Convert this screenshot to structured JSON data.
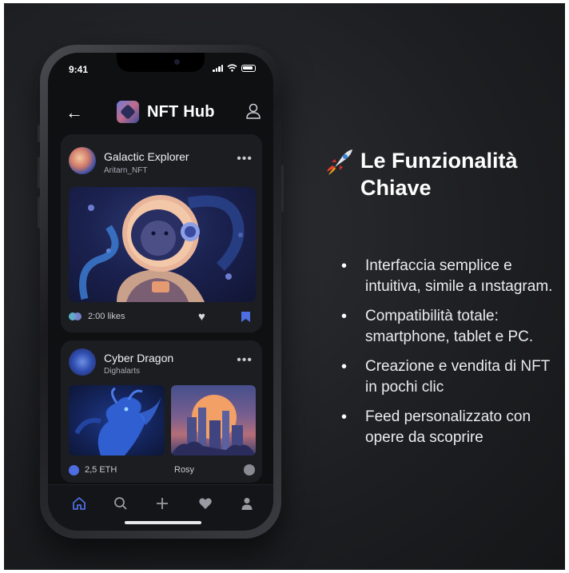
{
  "status": {
    "time": "9:41"
  },
  "app": {
    "title": "NFT Hub"
  },
  "posts": [
    {
      "title": "Galactic Explorer",
      "author": "Aritarn_NFT",
      "likes": "2:00 likes"
    },
    {
      "title": "Cyber Dragon",
      "author": "Dighalarts",
      "price": "2,5 ETH",
      "secondary_label": "Rosy"
    }
  ],
  "features": {
    "title": "Le Funzionalità Chiave",
    "items": [
      "Interfaccia semplice e intuitiva, simile a ınstagram.",
      "Compatibilità totale: smartphone, tablet e PC.",
      "Creazione e vendita di NFT in pochi clic",
      "Feed personalizzato con opere da scoprire"
    ]
  },
  "colors": {
    "accent": "#4d6de0",
    "background": "#1d1e21",
    "card": "#1c1d21"
  },
  "icons": [
    "back-arrow-icon",
    "profile-icon",
    "more-icon",
    "heart-icon",
    "bookmark-icon",
    "eth-icon",
    "home-icon",
    "search-icon",
    "plus-icon",
    "user-icon",
    "rocket-icon"
  ]
}
